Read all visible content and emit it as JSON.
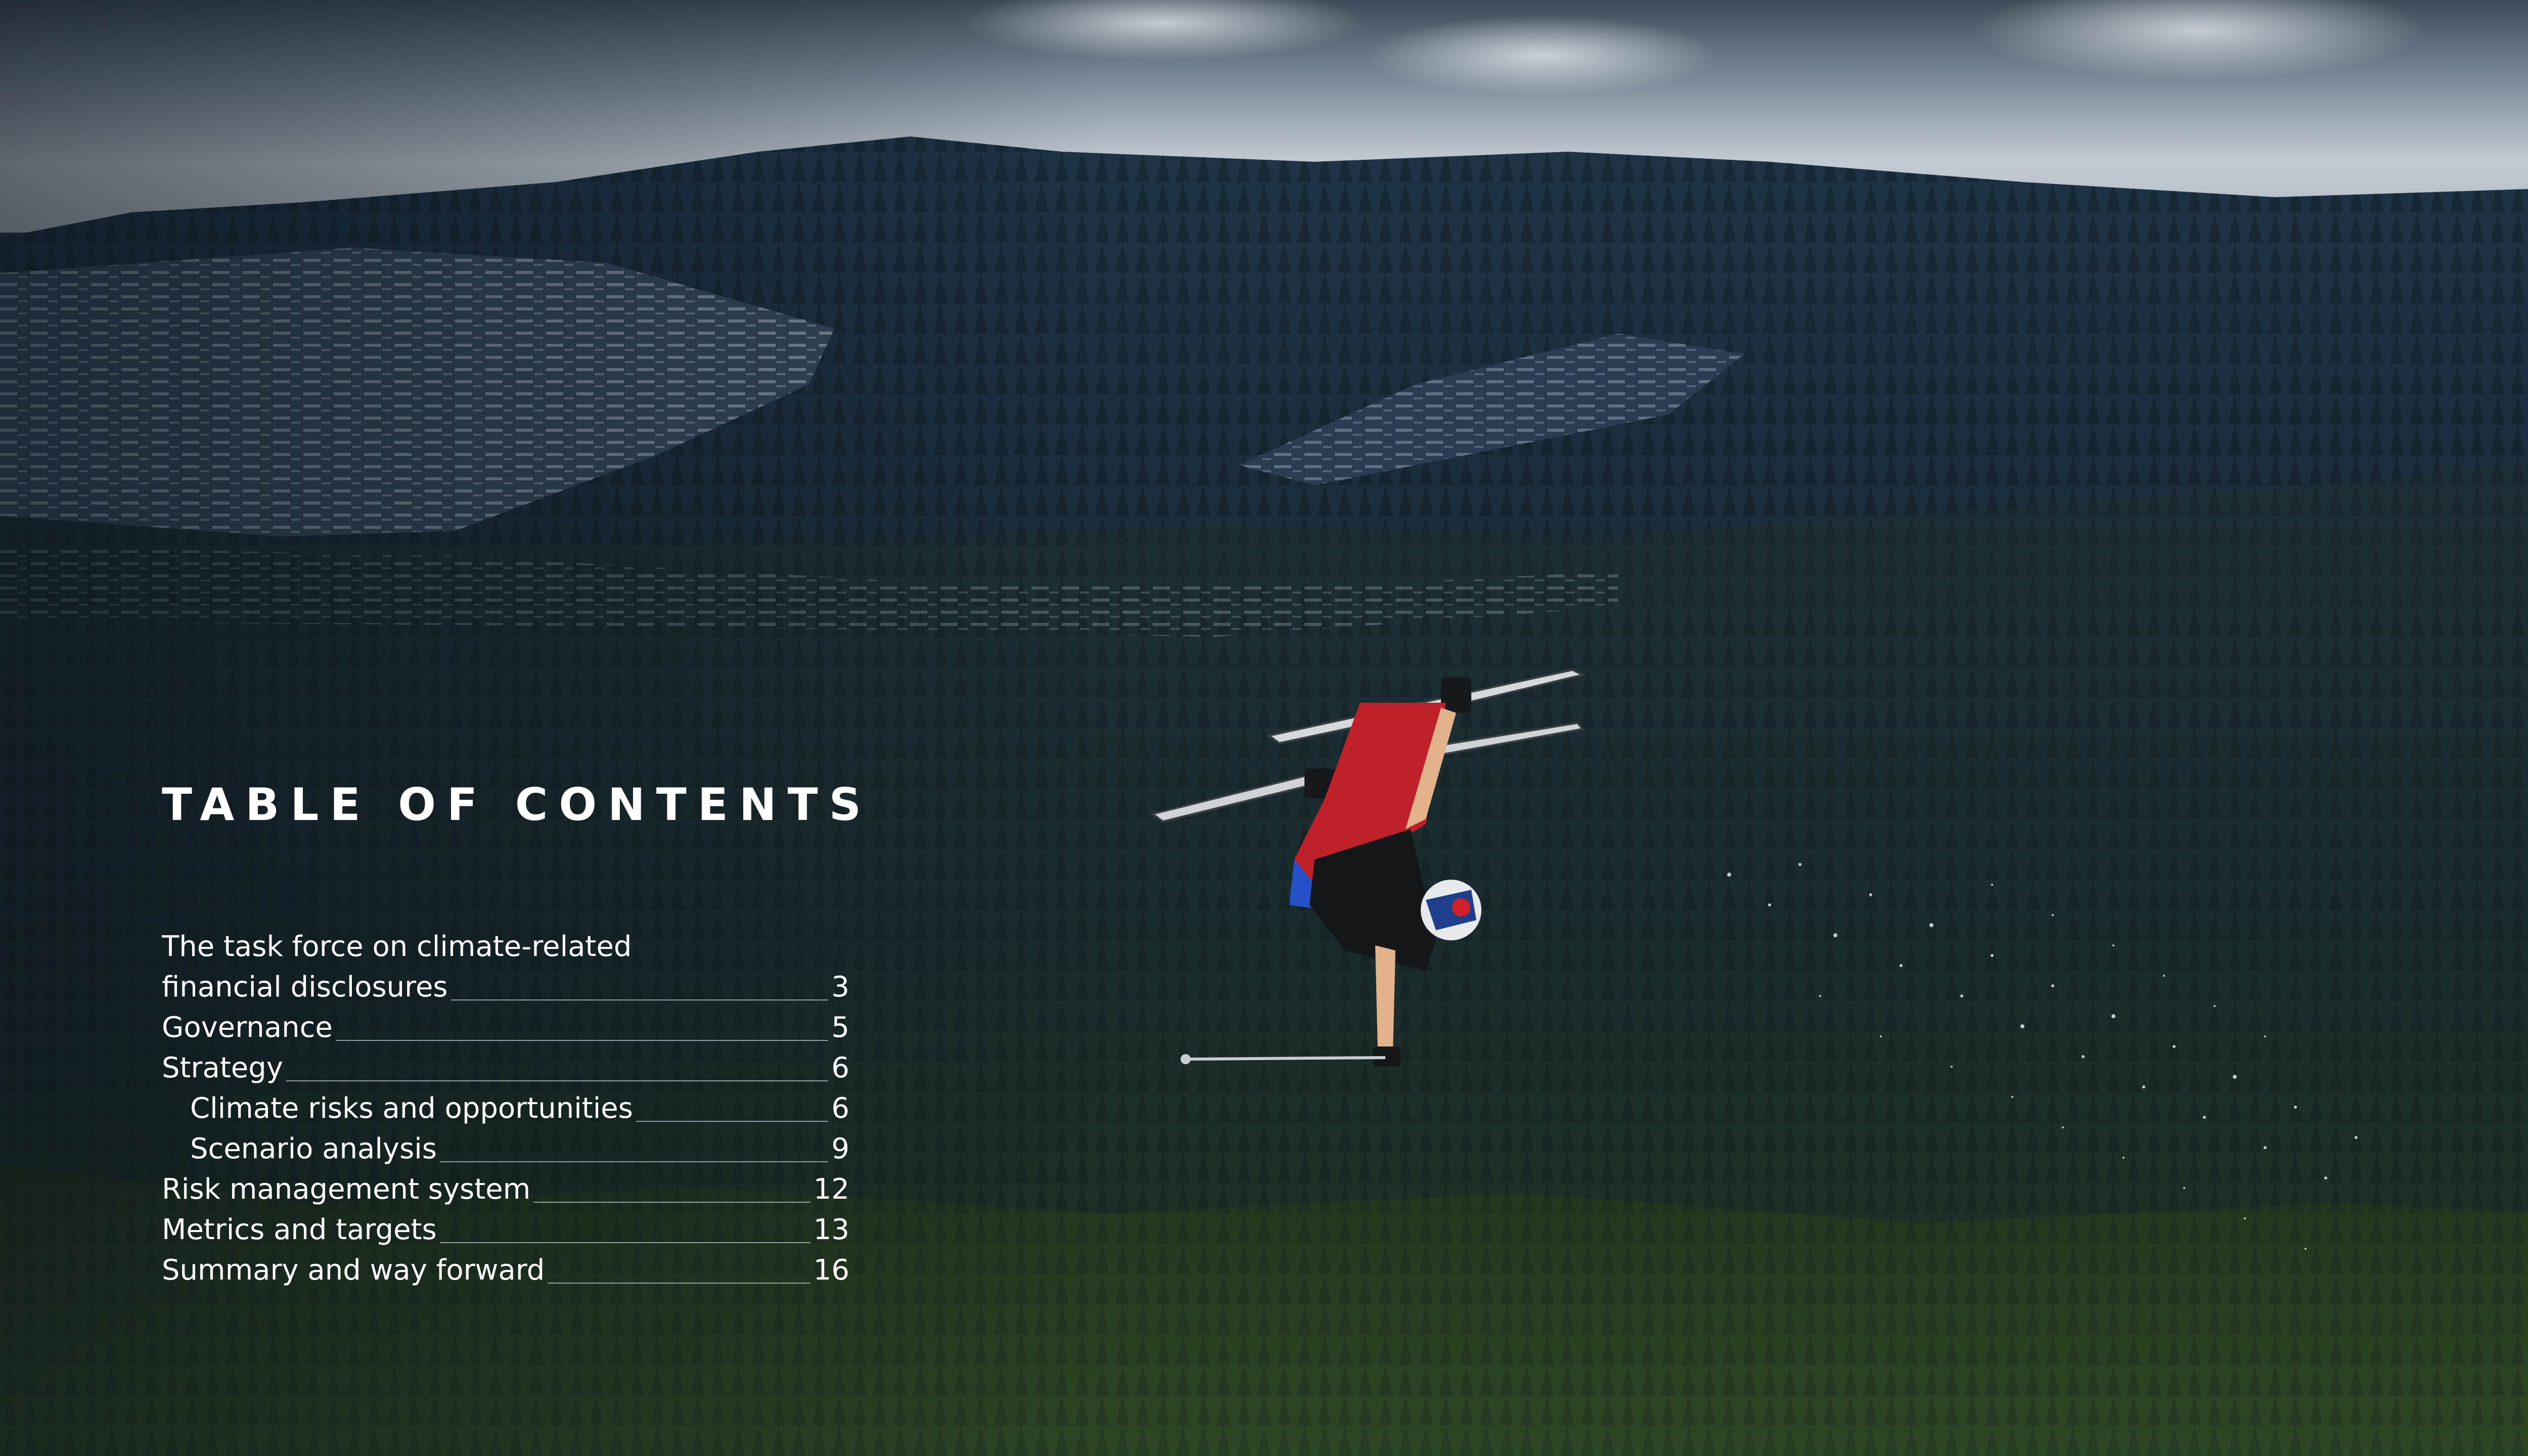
{
  "toc": {
    "title": "TABLE OF CONTENTS",
    "intro_line1": "The task force on climate-related",
    "entries": [
      {
        "label": "financial disclosures",
        "page": "3",
        "level": 1
      },
      {
        "label": "Governance",
        "page": "5",
        "level": 1
      },
      {
        "label": "Strategy",
        "page": "6",
        "level": 1
      },
      {
        "label": "Climate risks and opportunities",
        "page": "6",
        "level": 2
      },
      {
        "label": "Scenario analysis",
        "page": "9",
        "level": 2
      },
      {
        "label": "Risk management system",
        "page": "12",
        "level": 1
      },
      {
        "label": "Metrics and targets",
        "page": "13",
        "level": 1
      },
      {
        "label": "Summary and way forward",
        "page": "16",
        "level": 1
      }
    ]
  },
  "colors": {
    "text": "#ffffff",
    "leader": "#bec8d2",
    "forest_dark": "#1c2b33",
    "skier_pants": "#c0202a"
  }
}
